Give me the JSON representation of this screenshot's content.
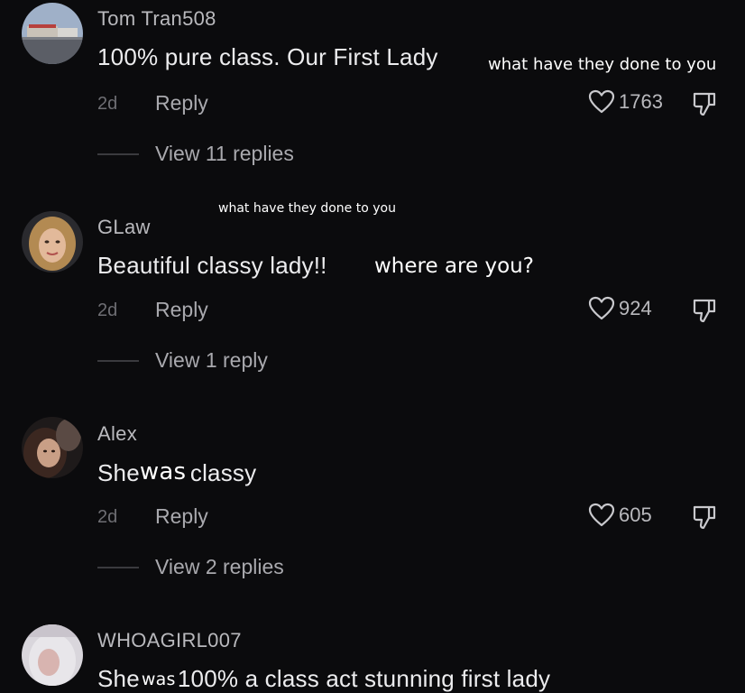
{
  "comments": [
    {
      "username": "Tom Tran508",
      "text": "100% pure class. Our First Lady",
      "age": "2d",
      "reply_label": "Reply",
      "likes": "1763",
      "view_replies": "View 11 replies"
    },
    {
      "username": "GLaw",
      "text": "Beautiful classy lady!!",
      "age": "2d",
      "reply_label": "Reply",
      "likes": "924",
      "view_replies": "View 1 reply"
    },
    {
      "username": "Alex",
      "text_before": "She",
      "text_after": "classy",
      "age": "2d",
      "reply_label": "Reply",
      "likes": "605",
      "view_replies": "View 2 replies"
    },
    {
      "username": "WHOAGIRL007",
      "text_before": "She",
      "text_after": "100% a class act stunning first lady"
    }
  ],
  "overlays": {
    "a": "what have they done to you",
    "b": "what have they done to you",
    "c": "where are you?",
    "d": "was",
    "e": "was"
  },
  "icons": {
    "like": "heart-outline-icon",
    "dislike": "thumbs-down-icon"
  },
  "colors": {
    "background": "#0b0b0d",
    "text": "#ececee",
    "muted": "#6e6e73"
  }
}
